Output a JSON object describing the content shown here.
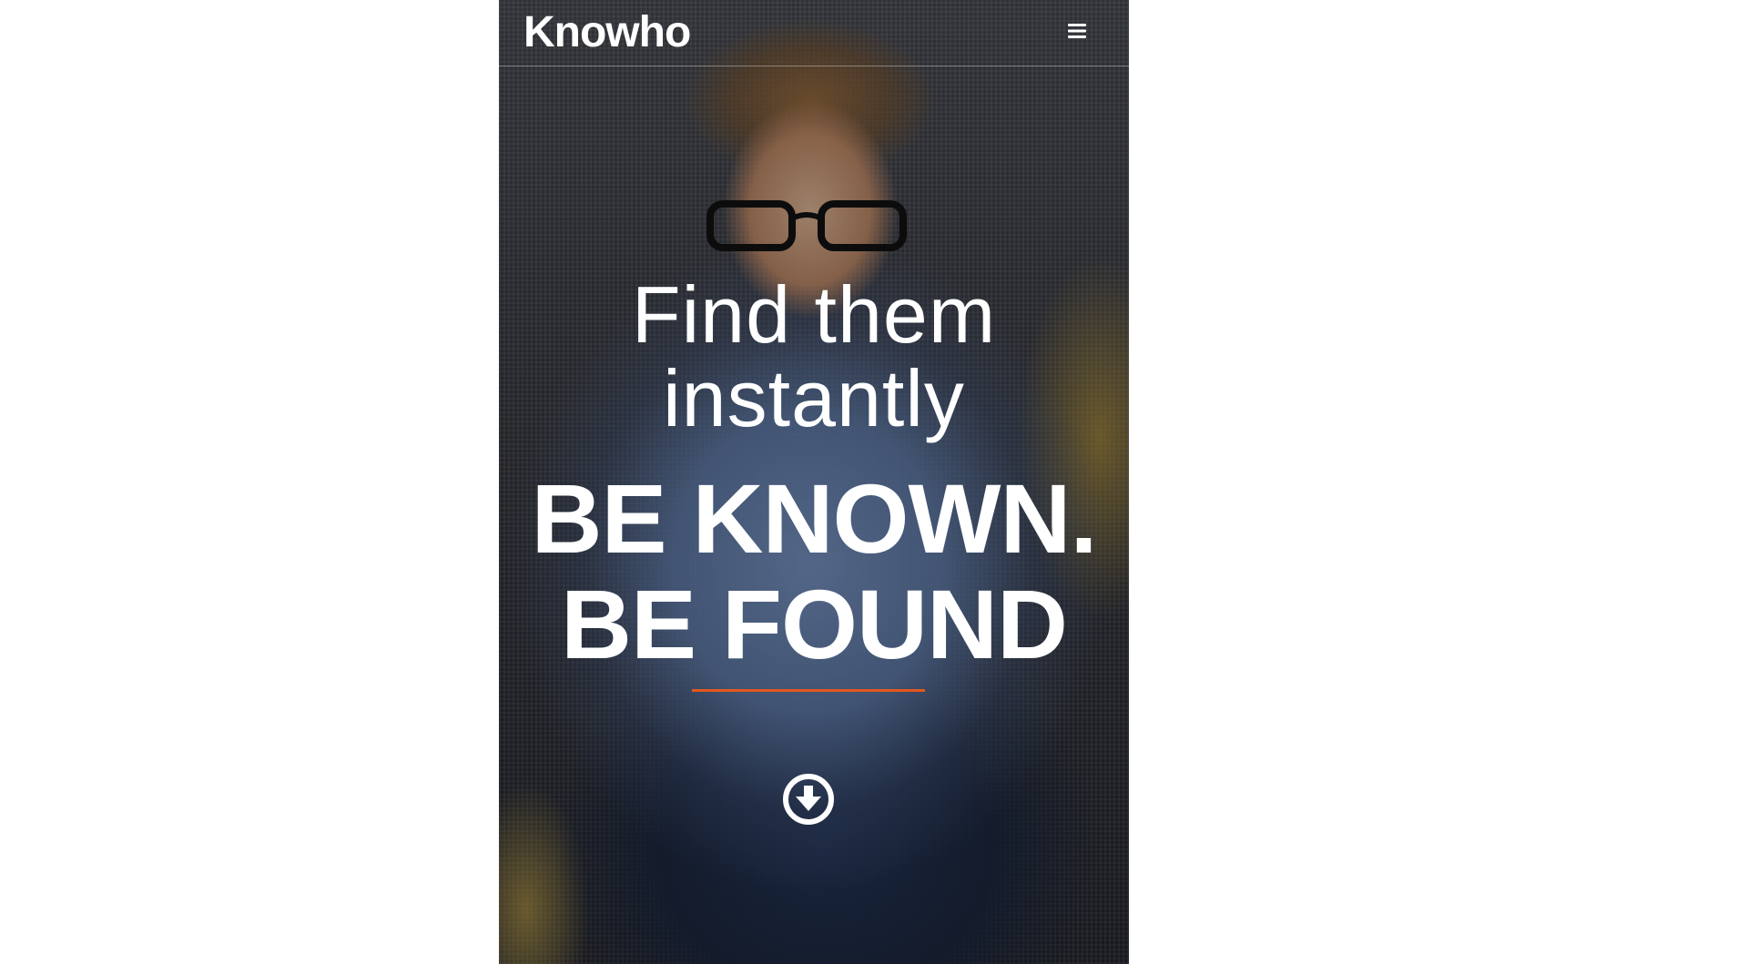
{
  "navbar": {
    "brand": "Knowho",
    "menu_icon": "hamburger-menu-icon"
  },
  "hero": {
    "subtitle_line1": "Find them",
    "subtitle_line2": "instantly",
    "title_line1": "BE KNOWN.",
    "title_line2": "BE FOUND",
    "scroll_icon": "arrow-circle-down-icon"
  },
  "colors": {
    "accent": "#e2571e",
    "text": "#ffffff",
    "page_background": "#ffffff"
  }
}
